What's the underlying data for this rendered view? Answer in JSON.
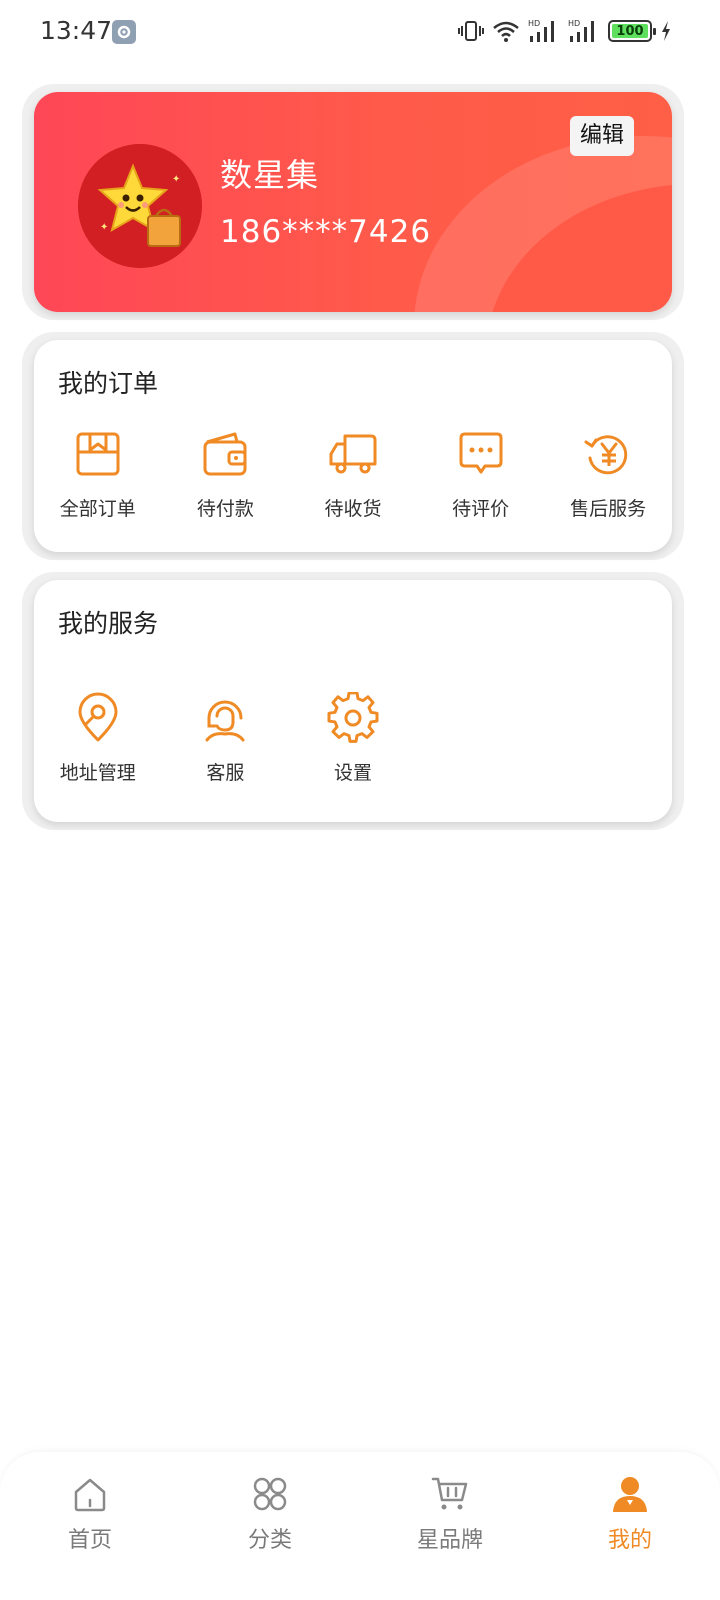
{
  "status_bar": {
    "time": "13:47",
    "battery": "100",
    "icons": [
      "gear-icon",
      "vibrate-icon",
      "wifi-icon",
      "signal-hd-icon",
      "signal-hd-icon",
      "battery-icon",
      "charging-icon"
    ]
  },
  "profile": {
    "name": "数星集",
    "phone": "186****7426",
    "edit_label": "编辑",
    "avatar_icon": "star-mascot-avatar"
  },
  "orders": {
    "title": "我的订单",
    "items": [
      {
        "label": "全部订单",
        "icon": "order-box-icon"
      },
      {
        "label": "待付款",
        "icon": "wallet-icon"
      },
      {
        "label": "待收货",
        "icon": "truck-icon"
      },
      {
        "label": "待评价",
        "icon": "comment-icon"
      },
      {
        "label": "售后服务",
        "icon": "refund-yen-icon"
      }
    ]
  },
  "services": {
    "title": "我的服务",
    "items": [
      {
        "label": "地址管理",
        "icon": "location-pin-icon"
      },
      {
        "label": "客服",
        "icon": "customer-service-icon"
      },
      {
        "label": "设置",
        "icon": "settings-gear-icon"
      }
    ]
  },
  "bottom_nav": {
    "items": [
      {
        "label": "首页",
        "icon": "home-icon"
      },
      {
        "label": "分类",
        "icon": "category-icon"
      },
      {
        "label": "星品牌",
        "icon": "cart-icon"
      },
      {
        "label": "我的",
        "icon": "user-icon",
        "active": true
      }
    ]
  },
  "colors": {
    "accent": "#f08a24",
    "profile_gradient_start": "#ff4757",
    "profile_gradient_end": "#ff5f46",
    "battery_fill": "#5ee05e"
  }
}
